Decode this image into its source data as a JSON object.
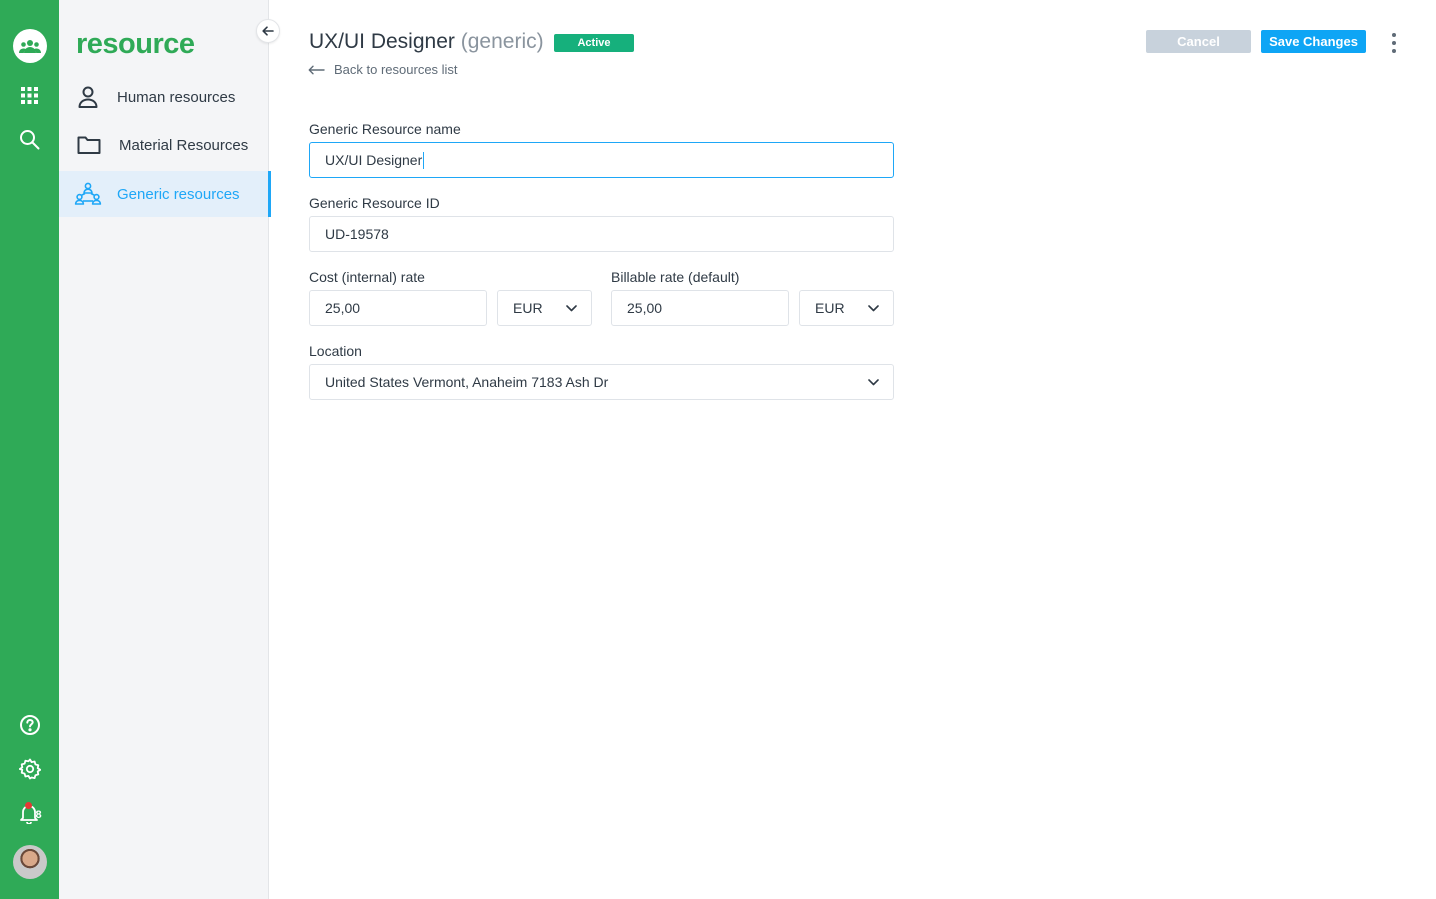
{
  "app": {
    "brand": "resource",
    "notifications_count": "8"
  },
  "sidebar": {
    "items": [
      {
        "label": "Human resources",
        "icon": "person-icon"
      },
      {
        "label": "Material Resources",
        "icon": "folder-icon"
      },
      {
        "label": "Generic resources",
        "icon": "people-network-icon",
        "active": true
      }
    ]
  },
  "header": {
    "title": "UX/UI Designer",
    "title_suffix": "(generic)",
    "status": "Active",
    "back_link": "Back to resources list",
    "cancel_label": "Cancel",
    "save_label": "Save Changes"
  },
  "form": {
    "name_label": "Generic Resource name",
    "name_value": "UX/UI Designer",
    "id_label": "Generic Resource ID",
    "id_value": "UD-19578",
    "cost_label": "Cost (internal) rate",
    "cost_value": "25,00",
    "cost_currency": "EUR",
    "billable_label": "Billable rate (default)",
    "billable_value": "25,00",
    "billable_currency": "EUR",
    "location_label": "Location",
    "location_value": "United States Vermont, Anaheim 7183 Ash Dr"
  },
  "colors": {
    "brand_green": "#2faa57",
    "accent_blue": "#0ea5f5",
    "status_active": "#16b07c"
  }
}
